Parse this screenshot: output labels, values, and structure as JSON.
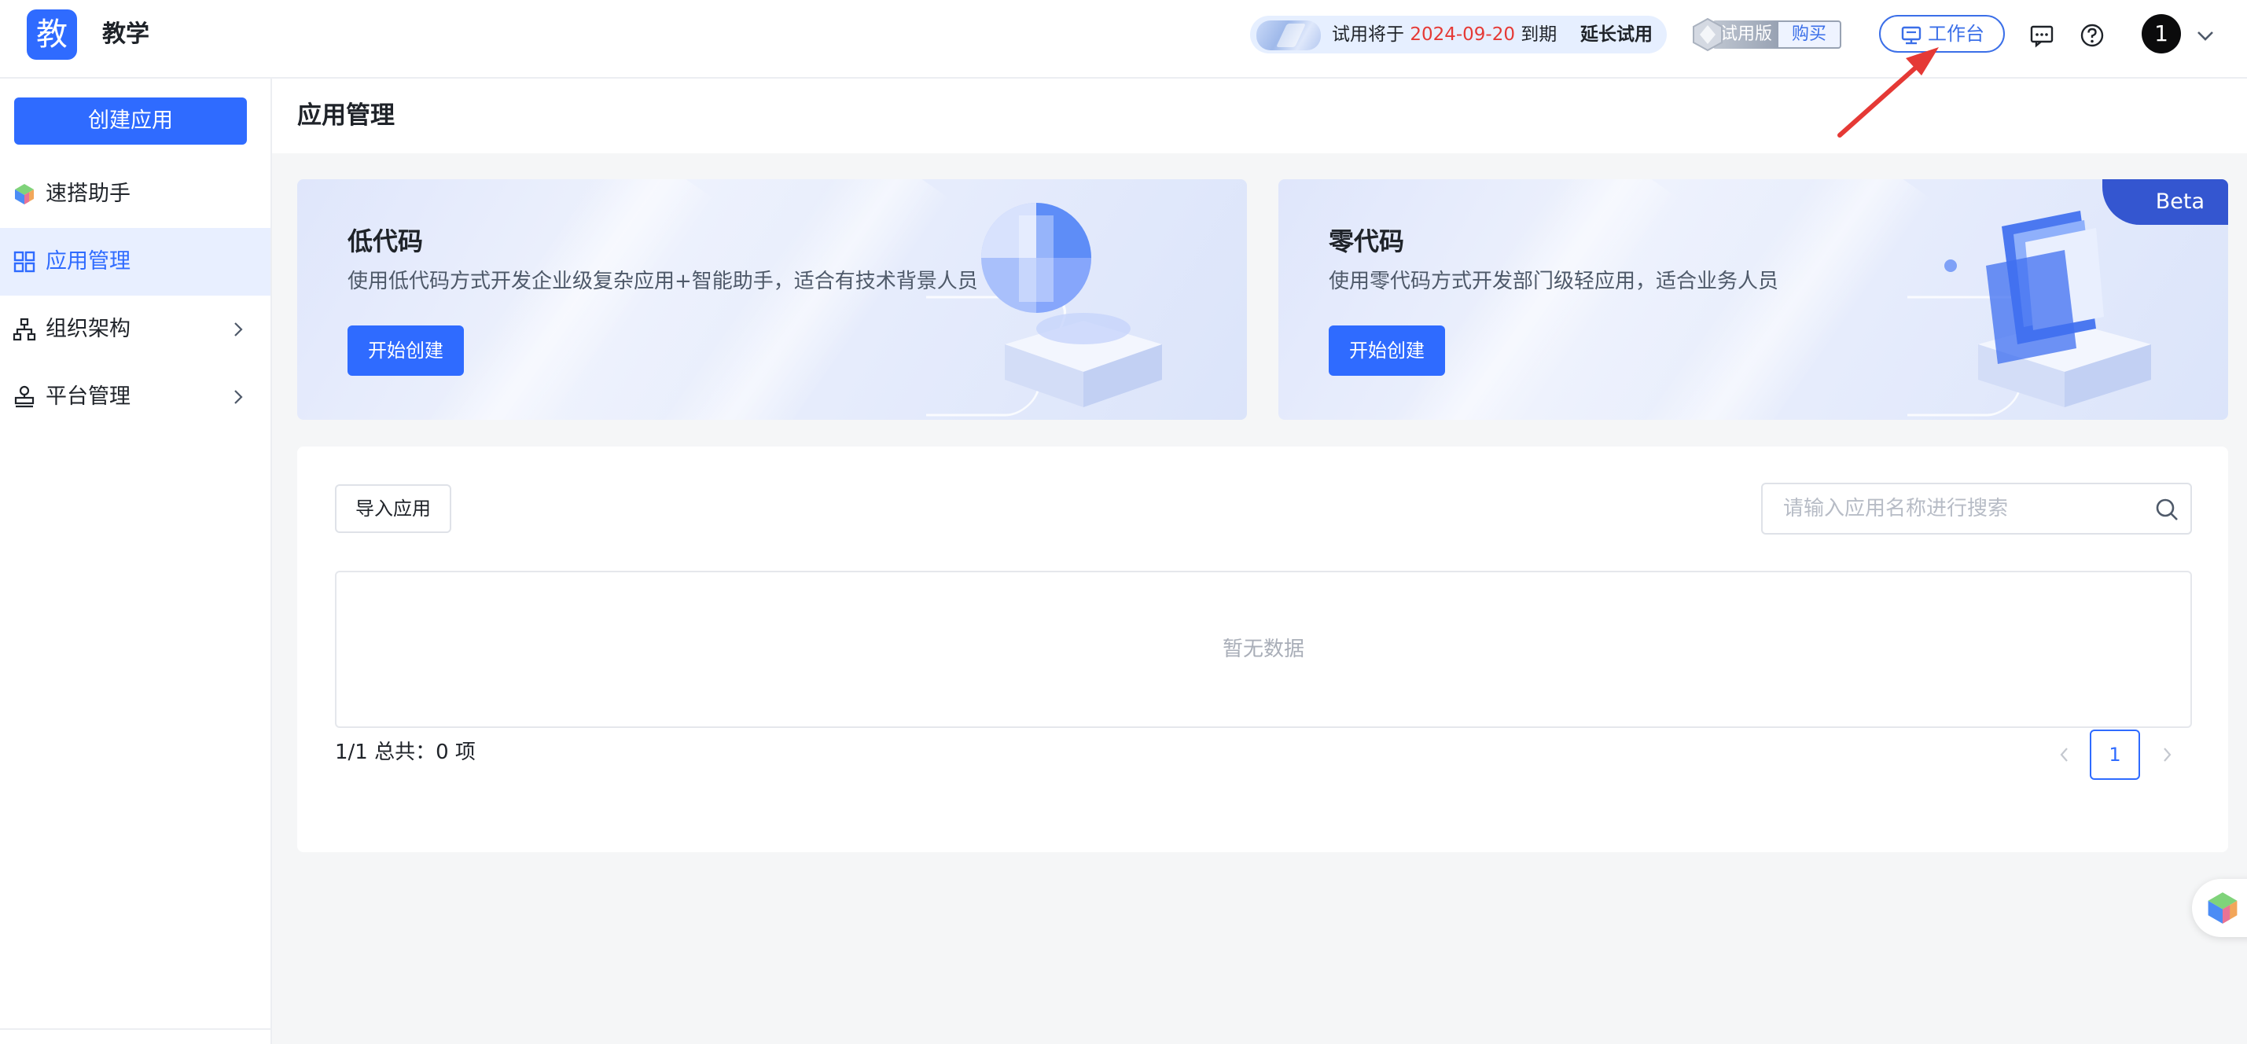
{
  "header": {
    "logo_char": "教",
    "app_name": "教学",
    "trial": {
      "prefix": "试用将于",
      "date": "2024-09-20",
      "suffix": "到期",
      "extend_label": "延长试用"
    },
    "version_label": "试用版",
    "buy_label": "购买",
    "workbench_label": "工作台",
    "avatar_text": "1",
    "icons": [
      "gem-icon",
      "monitor-icon",
      "message-icon",
      "help-icon",
      "chevron-down-icon"
    ]
  },
  "sidebar": {
    "create_label": "创建应用",
    "items": [
      {
        "label": "速搭助手",
        "icon": "cube-logo-icon",
        "active": false,
        "has_children": false
      },
      {
        "label": "应用管理",
        "icon": "grid-icon",
        "active": true,
        "has_children": false
      },
      {
        "label": "组织架构",
        "icon": "org-chart-icon",
        "active": false,
        "has_children": true
      },
      {
        "label": "平台管理",
        "icon": "stamp-icon",
        "active": false,
        "has_children": true
      }
    ]
  },
  "main": {
    "page_title": "应用管理",
    "cards": [
      {
        "title": "低代码",
        "desc": "使用低代码方式开发企业级复杂应用+智能助手，适合有技术背景人员",
        "button": "开始创建",
        "badge": ""
      },
      {
        "title": "零代码",
        "desc": "使用零代码方式开发部门级轻应用，适合业务人员",
        "button": "开始创建",
        "badge": "Beta"
      }
    ],
    "list": {
      "import_label": "导入应用",
      "search_placeholder": "请输入应用名称进行搜索",
      "search_value": "",
      "empty_text": "暂无数据",
      "summary": "1/1 总共：0 项",
      "current_page": "1"
    }
  },
  "colors": {
    "primary": "#2f6bff",
    "trial_date": "#e53935",
    "beta": "#3456d0",
    "annotation_arrow": "#e53935"
  }
}
